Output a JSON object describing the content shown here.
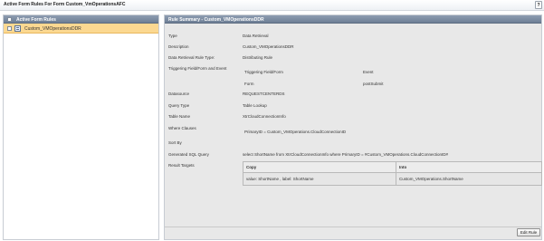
{
  "window": {
    "title": "Active Form Rules For Form Custom_VmOperationsAFC",
    "help_label": "?"
  },
  "left_panel": {
    "header": "Active Form Rules",
    "items": [
      {
        "label": "Custom_VMOperationsDDR",
        "selected": true
      }
    ]
  },
  "rule_summary": {
    "header": "Rule Summary - Custom_VMOperationsDDR",
    "fields": {
      "type": {
        "label": "Type",
        "value": "Data Retrieval"
      },
      "description": {
        "label": "Description",
        "value": "Custom_VMOperationsDDR"
      },
      "retrieval_rule_type": {
        "label": "Data Retrieval Rule Type:",
        "value": "Distributing Rule"
      },
      "triggering": {
        "label": "Triggering Field/Form and Event"
      },
      "datasource": {
        "label": "Datasource",
        "value": "REQUESTCENTERDS"
      },
      "query_type": {
        "label": "Query Type",
        "value": "Table Lookup"
      },
      "table_name": {
        "label": "Table Name",
        "value": "XtrCloudConnectionInfo"
      },
      "where_clauses": {
        "label": "Where Clauses",
        "value": "PrimaryID = Custom_VMOperations.CloudConnectionID"
      },
      "sort_by": {
        "label": "Sort By",
        "value": ""
      },
      "generated_sql": {
        "label": "Generated SQL Query",
        "value": "select ShortName from XtrCloudConnectionInfo where PrimaryID = #Custom_VMOperations.CloudConnectionID#"
      },
      "result_targets": {
        "label": "Result Targets"
      }
    },
    "triggering_table": {
      "col1_header": "Triggering Field/Form",
      "col2_header": "Event",
      "rows": [
        {
          "field": "Form",
          "event": "postSubmit"
        }
      ]
    },
    "result_targets_table": {
      "col1_header": "Copy",
      "col2_header": "Into",
      "rows": [
        {
          "copy": "value: ShortName , label: ShortName",
          "into": "Custom_VMOperations.ShortName"
        }
      ]
    },
    "edit_button_label": "Edit Rule"
  },
  "colors": {
    "panel_header": "#7b8ba1",
    "selected_row": "#fbd891",
    "content_bg": "#e8e8e8"
  }
}
